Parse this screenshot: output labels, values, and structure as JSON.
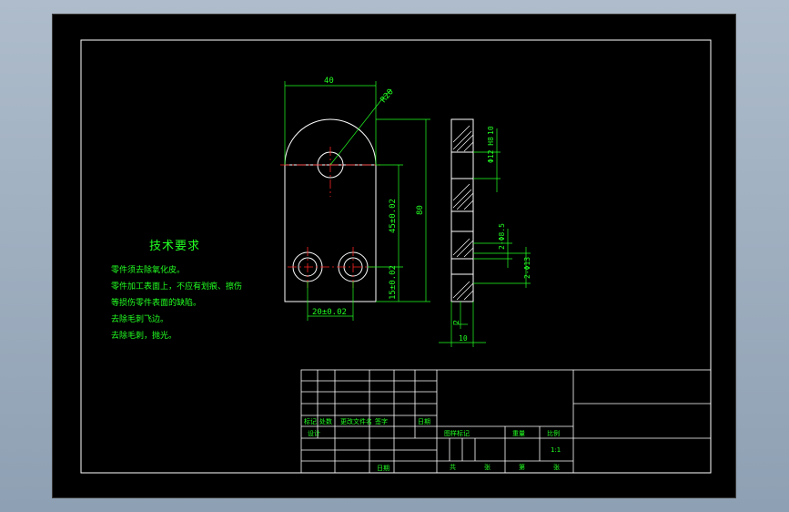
{
  "part": {
    "dim_width": "40",
    "dim_radius": "R20",
    "dim_height": "80",
    "dim_hole_center": "45±0.02",
    "dim_bottom_holes": "15±0.02",
    "dim_hole_spacing": "20±0.02",
    "side_dim_top": "10",
    "side_dim_top2": "Φ12 H8",
    "side_dim_mid": "2-Φ8.5",
    "side_dim_low": "2-Φ13",
    "side_dim_small": "2",
    "side_dim_thickness": "10"
  },
  "notes": {
    "title": "技术要求",
    "lines": [
      "零件须去除氧化皮。",
      "零件加工表面上，不应有划痕、擦伤",
      "等损伤零件表面的缺陷。",
      "去除毛刺飞边。",
      "去除毛刺，抛光。"
    ]
  },
  "title_block": {
    "row_labels": [
      "标记",
      "处数",
      "更改文件名",
      "签字",
      "日期"
    ],
    "design": "设计",
    "date": "日期",
    "stage": "图样标记",
    "weight": "重量",
    "scale": "比例",
    "scale_value": "1:1",
    "total": "共",
    "sheets": "张",
    "page": "第",
    "sheet": "张"
  },
  "colors": {
    "frame": "#ffffff",
    "outline": "#ffffff",
    "dimension": "#22ff22",
    "centerline": "#ff2222",
    "hatch": "#ffffff",
    "text": "#22ff22"
  }
}
